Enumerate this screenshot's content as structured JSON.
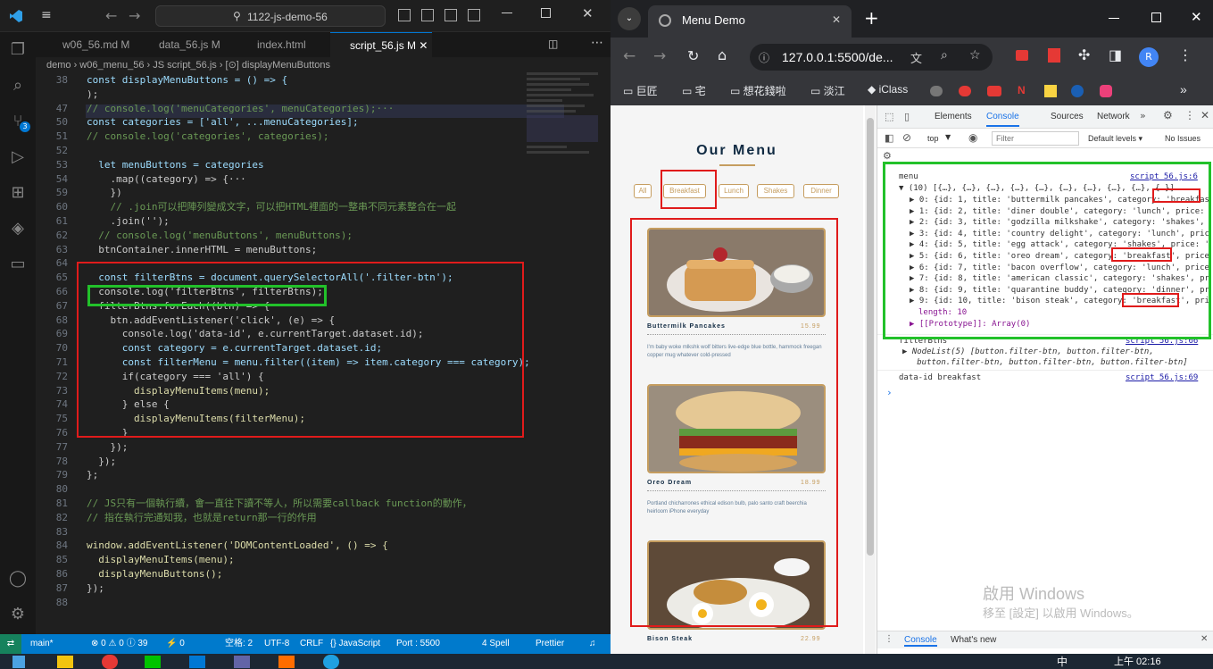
{
  "vscode": {
    "search": "1122-js-demo-56",
    "tabs": [
      "w06_56.md M",
      "data_56.js M",
      "index.html",
      "script_56.js M"
    ],
    "breadcrumb": "demo › w06_menu_56 › JS script_56.js › [⊙] displayMenuButtons",
    "lines": [
      {
        "n": "38",
        "t": "const displayMenuButtons = () => {"
      },
      {
        "n": "",
        "t": ");"
      },
      {
        "n": "47",
        "t": "// console.log('menuCategories', menuCategories);···"
      },
      {
        "n": "50",
        "t": "const categories = ['all', ...menuCategories];"
      },
      {
        "n": "51",
        "t": "// console.log('categories', categories);"
      },
      {
        "n": "52",
        "t": ""
      },
      {
        "n": "53",
        "t": "  let menuButtons = categories"
      },
      {
        "n": "54",
        "t": "    .map((category) => {···"
      },
      {
        "n": "59",
        "t": "    })"
      },
      {
        "n": "60",
        "t": "    // .join可以把陣列變成文字，可以把HTML裡面的一整串不同元素整合在一起"
      },
      {
        "n": "61",
        "t": "    .join('');"
      },
      {
        "n": "62",
        "t": "  // console.log('menuButtons', menuButtons);"
      },
      {
        "n": "63",
        "t": "  btnContainer.innerHTML = menuButtons;"
      },
      {
        "n": "64",
        "t": ""
      },
      {
        "n": "65",
        "t": "  const filterBtns = document.querySelectorAll('.filter-btn');"
      },
      {
        "n": "66",
        "t": "  console.log('filterBtns', filterBtns);"
      },
      {
        "n": "67",
        "t": "  filterBtns.forEach((btn) => {"
      },
      {
        "n": "68",
        "t": "    btn.addEventListener('click', (e) => {"
      },
      {
        "n": "69",
        "t": "      console.log('data-id', e.currentTarget.dataset.id);"
      },
      {
        "n": "70",
        "t": "      const category = e.currentTarget.dataset.id;"
      },
      {
        "n": "71",
        "t": "      const filterMenu = menu.filter((item) => item.category === category);"
      },
      {
        "n": "72",
        "t": "      if(category === 'all') {"
      },
      {
        "n": "73",
        "t": "        displayMenuItems(menu);"
      },
      {
        "n": "74",
        "t": "      } else {"
      },
      {
        "n": "75",
        "t": "        displayMenuItems(filterMenu);"
      },
      {
        "n": "76",
        "t": "      }"
      },
      {
        "n": "77",
        "t": "    });"
      },
      {
        "n": "78",
        "t": "  });"
      },
      {
        "n": "79",
        "t": "};"
      },
      {
        "n": "80",
        "t": ""
      },
      {
        "n": "81",
        "t": "// JS只有一個執行續，會一直往下讀不等人，所以需要callback function的動作，"
      },
      {
        "n": "82",
        "t": "// 指在執行完通知我，也就是return那一行的作用"
      },
      {
        "n": "83",
        "t": ""
      },
      {
        "n": "84",
        "t": "window.addEventListener('DOMContentLoaded', () => {"
      },
      {
        "n": "85",
        "t": "  displayMenuItems(menu);"
      },
      {
        "n": "86",
        "t": "  displayMenuButtons();"
      },
      {
        "n": "87",
        "t": "});"
      },
      {
        "n": "88",
        "t": ""
      }
    ],
    "status": {
      "branch": "main*",
      "problems": "⊗ 0 ⚠ 0 ⓘ 39",
      "ports": "⚡ 0",
      "spaces": "空格: 2",
      "enc": "UTF-8",
      "eol": "CRLF",
      "lang": "{} JavaScript",
      "port": "Port : 5500",
      "spell": "4 Spell",
      "prettier": "Prettier"
    }
  },
  "browser": {
    "tab_title": "Menu Demo",
    "url": "127.0.0.1:5500/de...",
    "bookmarks": [
      "巨匠",
      "宅",
      "想花錢啦",
      "淡江",
      "iClass"
    ],
    "page": {
      "title": "Our Menu",
      "filters": [
        "All",
        "Breakfast",
        "Lunch",
        "Shakes",
        "Dinner"
      ],
      "items": [
        {
          "name": "Buttermilk Pancakes",
          "price": "15.99",
          "desc": "I'm baby woke mlkshk wolf bitters live-edge blue bottle, hammock freegan copper mug whatever cold-pressed"
        },
        {
          "name": "Oreo Dream",
          "price": "18.99",
          "desc": "Portland chicharrones ethical edison bulb, palo santo craft beerchia heirloom iPhone everyday"
        },
        {
          "name": "Bison Steak",
          "price": "22.99",
          "desc": ""
        }
      ]
    },
    "devtools": {
      "tabs": [
        "Elements",
        "Console",
        "Sources",
        "Network"
      ],
      "context": "top",
      "filter_placeholder": "Filter",
      "levels": "Default levels ▾",
      "issues": "No Issues",
      "menu_label": "menu",
      "menu_src": "script_56.js:6",
      "array_head": "▼ (10) [{…}, {…}, {…}, {…}, {…}, {…}, {…}, {…}, {…}, {…}]",
      "rows": [
        "▶ 0: {id: 1, title: 'buttermilk pancakes', category: 'breakfas",
        "▶ 1: {id: 2, title: 'diner double', category: 'lunch', price:",
        "▶ 2: {id: 3, title: 'godzilla milkshake', category: 'shakes',",
        "▶ 3: {id: 4, title: 'country delight', category: 'lunch', pric",
        "▶ 4: {id: 5, title: 'egg attack', category: 'shakes', price: '",
        "▶ 5: {id: 6, title: 'oreo dream', category: 'breakfast', price",
        "▶ 6: {id: 7, title: 'bacon overflow', category: 'lunch', price",
        "▶ 7: {id: 8, title: 'american classic', category: 'shakes', pr",
        "▶ 8: {id: 9, title: 'quarantine buddy', category: 'dinner', pr",
        "▶ 9: {id: 10, title: 'bison steak', category: 'breakfast', pri"
      ],
      "length": "length: 10",
      "proto": "▶ [[Prototype]]: Array(0)",
      "filterbtns_label": "filterBtns",
      "filterbtns_src": "script_56.js:66",
      "nodelist1": "▶ NodeList(5) [button.filter-btn, button.filter-btn,",
      "nodelist2": "   button.filter-btn, button.filter-btn, button.filter-btn]",
      "dataid": "data-id breakfast",
      "dataid_src": "script_56.js:69",
      "bottom_tabs": [
        "Console",
        "What's new"
      ],
      "watermark1": "啟用 Windows",
      "watermark2": "移至 [設定] 以啟用 Windows。"
    }
  },
  "taskbar": {
    "time": "上午 02:16",
    "ime": "中"
  },
  "colors": {
    "vs_bg": "#1f1f1f",
    "status": "#007acc",
    "accent": "#c59d5f",
    "red": "#e01b1b",
    "green": "#22c12a"
  }
}
